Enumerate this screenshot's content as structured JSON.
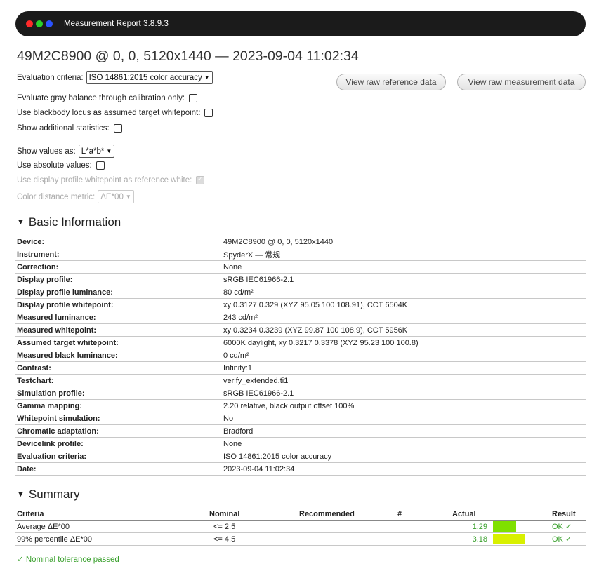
{
  "window": {
    "title": "Measurement Report 3.8.9.3",
    "dot_colors": [
      "#ff2a2a",
      "#2ad12a",
      "#2a52ff"
    ]
  },
  "heading": "49M2C8900 @ 0, 0, 5120x1440 — 2023-09-04 11:02:34",
  "options": {
    "eval_label": "Evaluation criteria:",
    "eval_value": "ISO 14861:2015 color accuracy",
    "gray_balance_label": "Evaluate gray balance through calibration only:",
    "blackbody_label": "Use blackbody locus as assumed target whitepoint:",
    "additional_stats_label": "Show additional statistics:",
    "show_values_label": "Show values as:",
    "show_values_value": "L*a*b*",
    "absolute_label": "Use absolute values:",
    "display_whitepoint_label": "Use display profile whitepoint as reference white:",
    "distance_label": "Color distance metric:",
    "distance_value": "ΔE*00"
  },
  "buttons": {
    "raw_reference": "View raw reference data",
    "raw_measurement": "View raw measurement data"
  },
  "basic": {
    "title": "Basic Information",
    "rows": [
      {
        "k": "Device:",
        "v": "49M2C8900 @ 0, 0, 5120x1440"
      },
      {
        "k": "Instrument:",
        "v": "SpyderX — 常规"
      },
      {
        "k": "Correction:",
        "v": "None"
      },
      {
        "k": "Display profile:",
        "v": "sRGB IEC61966-2.1"
      },
      {
        "k": "Display profile luminance:",
        "v": "80 cd/m²"
      },
      {
        "k": "Display profile whitepoint:",
        "v": "xy 0.3127 0.329 (XYZ 95.05 100 108.91), CCT 6504K"
      },
      {
        "k": "Measured luminance:",
        "v": "243 cd/m²"
      },
      {
        "k": "Measured whitepoint:",
        "v": "xy 0.3234 0.3239 (XYZ 99.87 100 108.9), CCT 5956K"
      },
      {
        "k": "Assumed target whitepoint:",
        "v": "6000K daylight, xy 0.3217 0.3378 (XYZ 95.23 100 100.8)"
      },
      {
        "k": "Measured black luminance:",
        "v": "0 cd/m²"
      },
      {
        "k": "Contrast:",
        "v": "Infinity:1"
      },
      {
        "k": "Testchart:",
        "v": "verify_extended.ti1"
      },
      {
        "k": "Simulation profile:",
        "v": "sRGB IEC61966-2.1"
      },
      {
        "k": "Gamma mapping:",
        "v": "2.20 relative, black output offset 100%"
      },
      {
        "k": "Whitepoint simulation:",
        "v": "No"
      },
      {
        "k": "Chromatic adaptation:",
        "v": "Bradford"
      },
      {
        "k": "Devicelink profile:",
        "v": "None"
      },
      {
        "k": "Evaluation criteria:",
        "v": "ISO 14861:2015 color accuracy"
      },
      {
        "k": "Date:",
        "v": "2023-09-04 11:02:34"
      }
    ]
  },
  "summary": {
    "title": "Summary",
    "headers": {
      "criteria": "Criteria",
      "nominal": "Nominal",
      "recommended": "Recommended",
      "hash": "#",
      "actual": "Actual",
      "result": "Result"
    },
    "rows": [
      {
        "criteria": "Average ΔE*00",
        "nominal": "<= 2.5",
        "recommended": "",
        "hash": "",
        "actual": "1.29",
        "result": "OK ✓",
        "bar_color": "#7fe000",
        "fraction_of_nominal": 0.52
      },
      {
        "criteria": "99% percentile ΔE*00",
        "nominal": "<= 4.5",
        "recommended": "",
        "hash": "",
        "actual": "3.18",
        "result": "OK ✓",
        "bar_color": "#d8f000",
        "fraction_of_nominal": 0.71
      }
    ],
    "passed": "✓ Nominal tolerance passed"
  }
}
